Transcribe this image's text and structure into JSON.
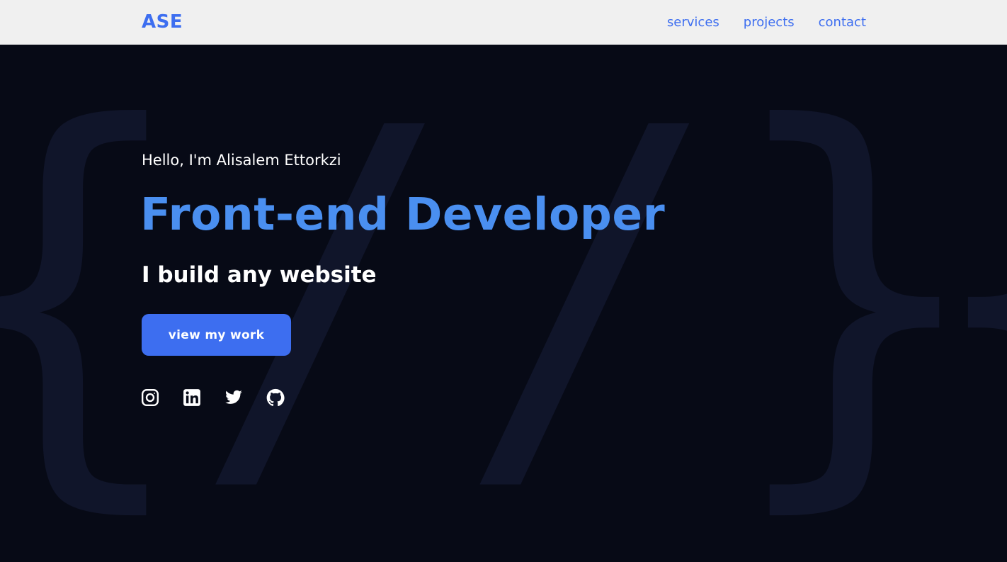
{
  "navbar": {
    "logo": "ASE",
    "links": [
      {
        "label": "services"
      },
      {
        "label": "projects"
      },
      {
        "label": "contact"
      }
    ]
  },
  "hero": {
    "greeting": "Hello, I'm Alisalem Ettorkzi",
    "headline": "Front-end Developer",
    "subheadline": "I build any website",
    "cta_label": "view my work",
    "socials": [
      {
        "icon": "instagram-icon"
      },
      {
        "icon": "linkedin-icon"
      },
      {
        "icon": "twitter-icon"
      },
      {
        "icon": "github-icon"
      }
    ]
  },
  "colors": {
    "accent": "#3d6ef0",
    "headline": "#4a8ff0",
    "hero_background": "#070a16",
    "navbar_background": "#f0f0f0"
  }
}
